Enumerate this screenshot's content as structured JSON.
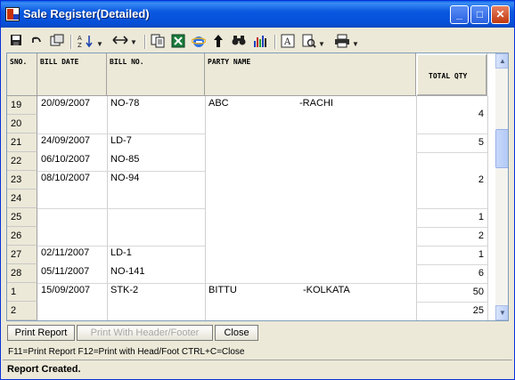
{
  "window": {
    "title": "Sale Register(Detailed)"
  },
  "title_buttons": {
    "minimize": "_",
    "maximize": "□",
    "close": "✕"
  },
  "toolbar": {
    "items": [
      "save-icon",
      "undo-icon",
      "print-preview-icon",
      "sort-icon",
      "column-width-icon",
      "copy-icon",
      "excel-icon",
      "internet-explorer-icon",
      "up-arrow-icon",
      "binoculars-icon",
      "chart-icon",
      "font-icon",
      "page-setup-icon",
      "printer-icon"
    ]
  },
  "grid": {
    "headers": {
      "sno": "SNO.",
      "bill_date": "BILL DATE",
      "bill_no": "BILL NO.",
      "party_name": "PARTY NAME",
      "total_qty": "TOTAL QTY"
    },
    "rows": [
      {
        "sno": "19",
        "date": "20/09/2007",
        "bill": "NO-78",
        "party": "ABC",
        "city": "-RACHI",
        "qty": "4"
      },
      {
        "sno": "20",
        "date": "",
        "bill": "",
        "party": "",
        "city": "",
        "qty": ""
      },
      {
        "sno": "21",
        "date": "24/09/2007",
        "bill": "LD-7",
        "party": "",
        "city": "",
        "qty": "5"
      },
      {
        "sno": "22",
        "date": "06/10/2007",
        "bill": "NO-85",
        "party": "",
        "city": "",
        "qty": ""
      },
      {
        "sno": "23",
        "date": "08/10/2007",
        "bill": "NO-94",
        "party": "",
        "city": "",
        "qty": "2"
      },
      {
        "sno": "24",
        "date": "",
        "bill": "",
        "party": "",
        "city": "",
        "qty": ""
      },
      {
        "sno": "25",
        "date": "",
        "bill": "",
        "party": "",
        "city": "",
        "qty": "1"
      },
      {
        "sno": "26",
        "date": "",
        "bill": "",
        "party": "",
        "city": "",
        "qty": "2"
      },
      {
        "sno": "27",
        "date": "02/11/2007",
        "bill": "LD-1",
        "party": "",
        "city": "",
        "qty": "1"
      },
      {
        "sno": "28",
        "date": "05/11/2007",
        "bill": "NO-141",
        "party": "",
        "city": "",
        "qty": "6"
      },
      {
        "sno": "1",
        "date": "15/09/2007",
        "bill": "STK-2",
        "party": "BITTU",
        "city": "-KOLKATA",
        "qty": "50"
      },
      {
        "sno": "2",
        "date": "",
        "bill": "",
        "party": "",
        "city": "",
        "qty": "25"
      }
    ]
  },
  "buttons": {
    "print_report": "Print Report",
    "print_header_footer": "Print With Header/Footer",
    "close": "Close"
  },
  "hint": "F11=Print Report  F12=Print with Head/Foot  CTRL+C=Close",
  "status": "Report Created."
}
